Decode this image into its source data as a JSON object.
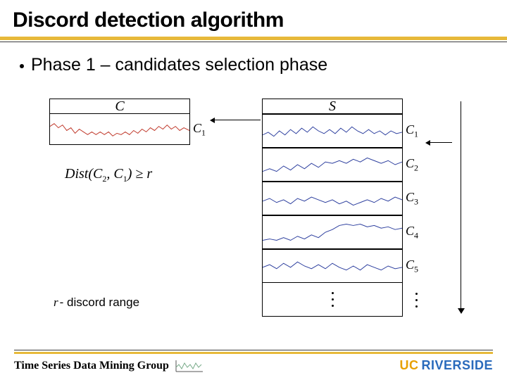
{
  "title": "Discord detection algorithm",
  "bullet": "Phase 1 – candidates selection phase",
  "panels": {
    "c_header": "C",
    "s_header": "S",
    "c_rows": [
      {
        "label_var": "C",
        "label_sub": "1"
      }
    ],
    "s_rows": [
      {
        "label_var": "C",
        "label_sub": "1"
      },
      {
        "label_var": "C",
        "label_sub": "2"
      },
      {
        "label_var": "C",
        "label_sub": "3"
      },
      {
        "label_var": "C",
        "label_sub": "4"
      },
      {
        "label_var": "C",
        "label_sub": "5"
      }
    ]
  },
  "formula": {
    "func": "Dist",
    "arg1_var": "C",
    "arg1_sub": "2",
    "arg2_var": "C",
    "arg2_sub": "1",
    "op": "≥",
    "rhs": "r"
  },
  "legend": {
    "var": "r",
    "dash": "-",
    "text": "discord range"
  },
  "footer": {
    "group": "Time Series Data Mining Group",
    "uni_prefix": "UC",
    "uni_name": "RIVERSIDE"
  }
}
